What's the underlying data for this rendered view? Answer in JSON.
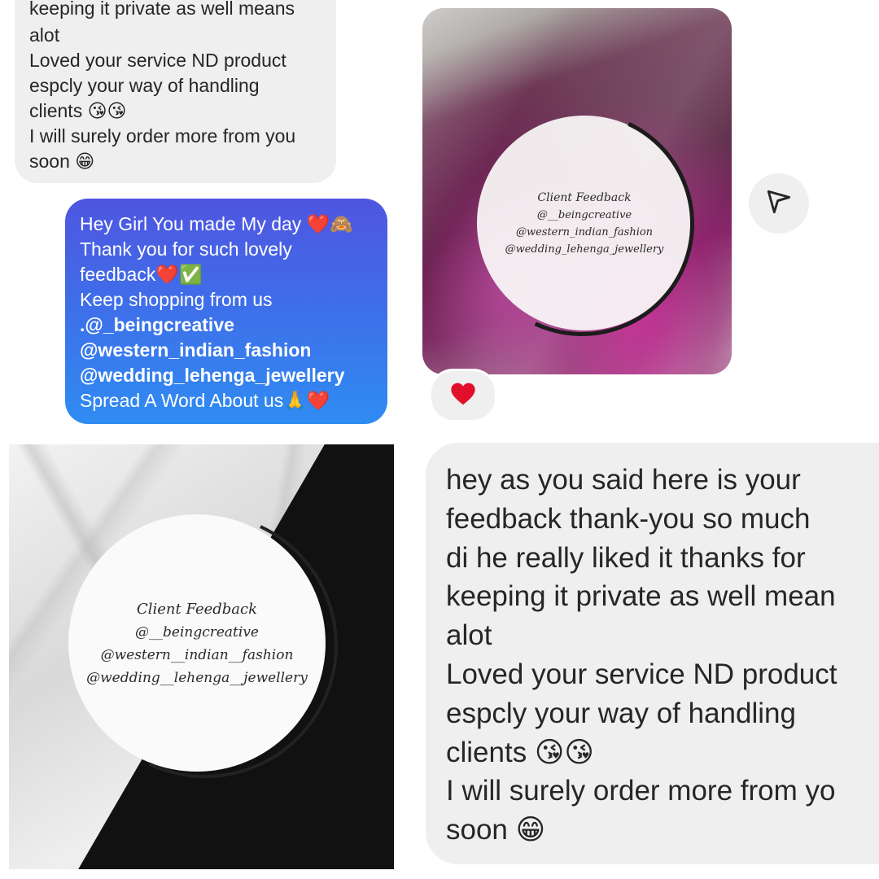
{
  "colors": {
    "incoming_bubble": "#efefef",
    "outgoing_gradient_top": "#4f55e0",
    "outgoing_gradient_bottom": "#2f8cf2",
    "text": "#262626",
    "heart": "#e0102a"
  },
  "top_left_message": {
    "partial_first_line": "keeping it private as well means",
    "lines": "alot\nLoved your service ND product\nespcly your way of handling\nclients 😘😘\nI will surely order more from you\nsoon 😁"
  },
  "reply_message": {
    "line1": "Hey Girl You made My day ❤️🙈",
    "line2": "Thank you for such lovely",
    "line3": "feedback❤️✅",
    "line4": "Keep shopping from us",
    "line5": ".@_beingcreative",
    "line6": "@western_indian_fashion",
    "line7": "@wedding_lehenga_jewellery",
    "line8": "Spread A Word About us🙏❤️"
  },
  "photo_badge": {
    "title": "Client Feedback",
    "handle1": "@__beingcreative",
    "handle2": "@western_indian_fashion",
    "handle3": "@wedding_lehenga_jewellery"
  },
  "share_icon": "paper-plane-icon",
  "reaction": {
    "emoji": "❤️",
    "icon": "heart-icon"
  },
  "marble_badge": {
    "title": "Client Feedback",
    "handle1": "@__beingcreative",
    "handle2": "@western__indian__fashion",
    "handle3": "@wedding__lehenga__jewellery"
  },
  "big_message": {
    "text": "hey as you said here is your\nfeedback thank-you so much\ndi he really liked it thanks for\nkeeping it private as well mean\nalot\nLoved your service ND product\nespcly your way of handling\nclients 😘😘\nI will surely order more from yo\nsoon 😁"
  }
}
